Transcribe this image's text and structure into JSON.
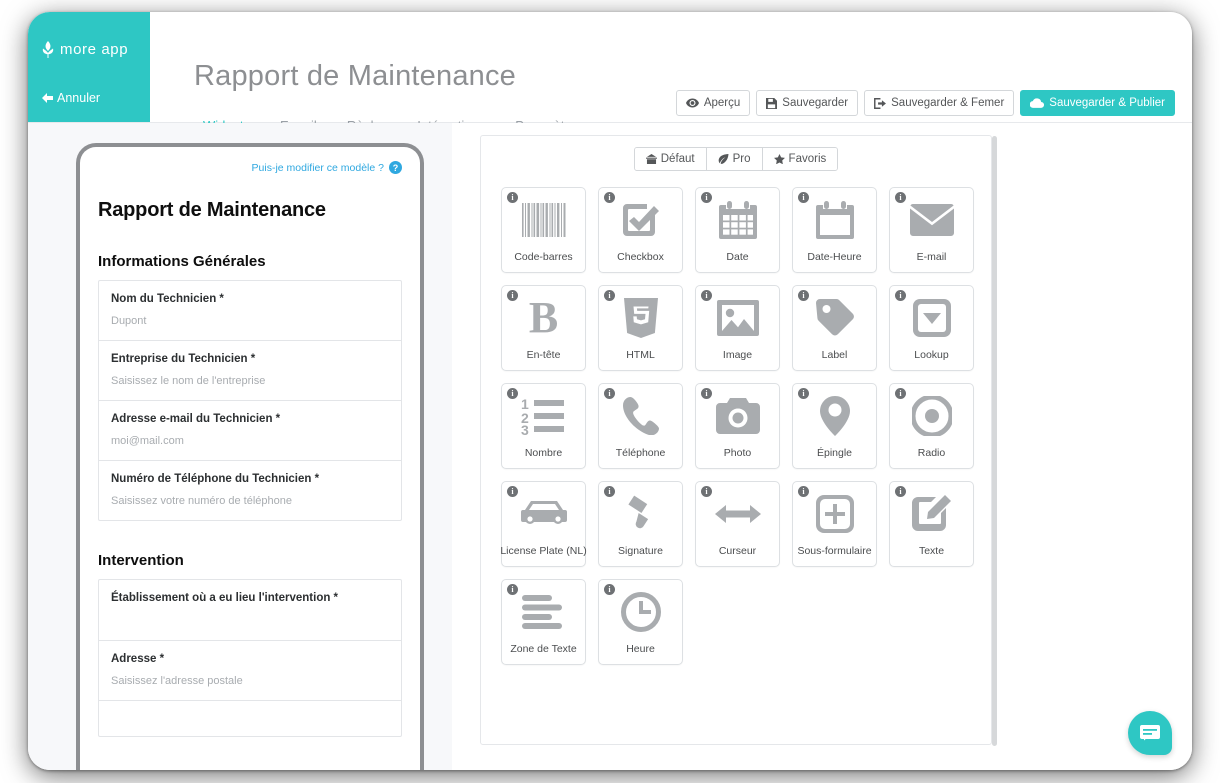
{
  "brand": {
    "name": "more app",
    "cancel_label": "Annuler",
    "logo_icon": "moreapp-leaf-icon",
    "back_icon": "arrow-left-icon",
    "accent_color": "#2ec7c4"
  },
  "header": {
    "title": "Rapport de Maintenance",
    "tabs": [
      {
        "label": "Widgets",
        "active": true
      },
      {
        "label": "E-mail",
        "active": false
      },
      {
        "label": "Règles",
        "active": false
      },
      {
        "label": "Intégrations",
        "active": false
      },
      {
        "label": "Paramètres",
        "active": false
      }
    ],
    "actions": [
      {
        "label": "Aperçu",
        "icon": "eye-icon",
        "primary": false
      },
      {
        "label": "Sauvegarder",
        "icon": "floppy-disk-icon",
        "primary": false
      },
      {
        "label": "Sauvegarder & Femer",
        "icon": "sign-out-icon",
        "primary": false
      },
      {
        "label": "Sauvegarder & Publier",
        "icon": "cloud-upload-icon",
        "primary": true
      }
    ]
  },
  "preview": {
    "modify_link": "Puis-je modifier ce modèle ?",
    "help_badge": "?",
    "form_title": "Rapport de Maintenance",
    "sections": [
      {
        "title": "Informations Générales",
        "fields": [
          {
            "label": "Nom du Technicien *",
            "placeholder": "Dupont"
          },
          {
            "label": "Entreprise du Technicien *",
            "placeholder": "Saisissez le nom de l'entreprise"
          },
          {
            "label": "Adresse e-mail du Technicien *",
            "placeholder": "moi@mail.com"
          },
          {
            "label": "Numéro de Téléphone du Technicien *",
            "placeholder": "Saisissez votre numéro de téléphone"
          }
        ]
      },
      {
        "title": "Intervention",
        "fields": [
          {
            "label": "Établissement où a eu lieu l'intervention *",
            "placeholder": ""
          },
          {
            "label": "Adresse *",
            "placeholder": "Saisissez l'adresse postale"
          }
        ]
      }
    ]
  },
  "widgets": {
    "filters": [
      {
        "label": "Défaut",
        "icon": "grid-icon",
        "active": false
      },
      {
        "label": "Pro",
        "icon": "leaf-icon",
        "active": false
      },
      {
        "label": "Favoris",
        "icon": "star-icon",
        "active": false
      }
    ],
    "info_badge": "i",
    "items": [
      {
        "label": "Code-barres",
        "icon": "barcode-icon"
      },
      {
        "label": "Checkbox",
        "icon": "checkbox-icon"
      },
      {
        "label": "Date",
        "icon": "calendar-grid-icon"
      },
      {
        "label": "Date-Heure",
        "icon": "calendar-icon"
      },
      {
        "label": "E-mail",
        "icon": "envelope-icon"
      },
      {
        "label": "En-tête",
        "icon": "bold-b-icon"
      },
      {
        "label": "HTML",
        "icon": "html5-shield-icon"
      },
      {
        "label": "Image",
        "icon": "picture-icon"
      },
      {
        "label": "Label",
        "icon": "tag-icon"
      },
      {
        "label": "Lookup",
        "icon": "dropdown-caret-icon"
      },
      {
        "label": "Nombre",
        "icon": "numbered-list-icon"
      },
      {
        "label": "Téléphone",
        "icon": "phone-icon"
      },
      {
        "label": "Photo",
        "icon": "camera-icon"
      },
      {
        "label": "Épingle",
        "icon": "map-pin-icon"
      },
      {
        "label": "Radio",
        "icon": "radio-button-icon"
      },
      {
        "label": "License Plate (NL)",
        "icon": "car-icon"
      },
      {
        "label": "Signature",
        "icon": "signature-pen-icon"
      },
      {
        "label": "Curseur",
        "icon": "arrows-horizontal-icon"
      },
      {
        "label": "Sous-formulaire",
        "icon": "plus-square-icon"
      },
      {
        "label": "Texte",
        "icon": "pencil-square-icon"
      },
      {
        "label": "Zone de Texte",
        "icon": "text-lines-icon"
      },
      {
        "label": "Heure",
        "icon": "clock-icon"
      }
    ]
  },
  "chat": {
    "icon": "chat-bubble-icon"
  }
}
